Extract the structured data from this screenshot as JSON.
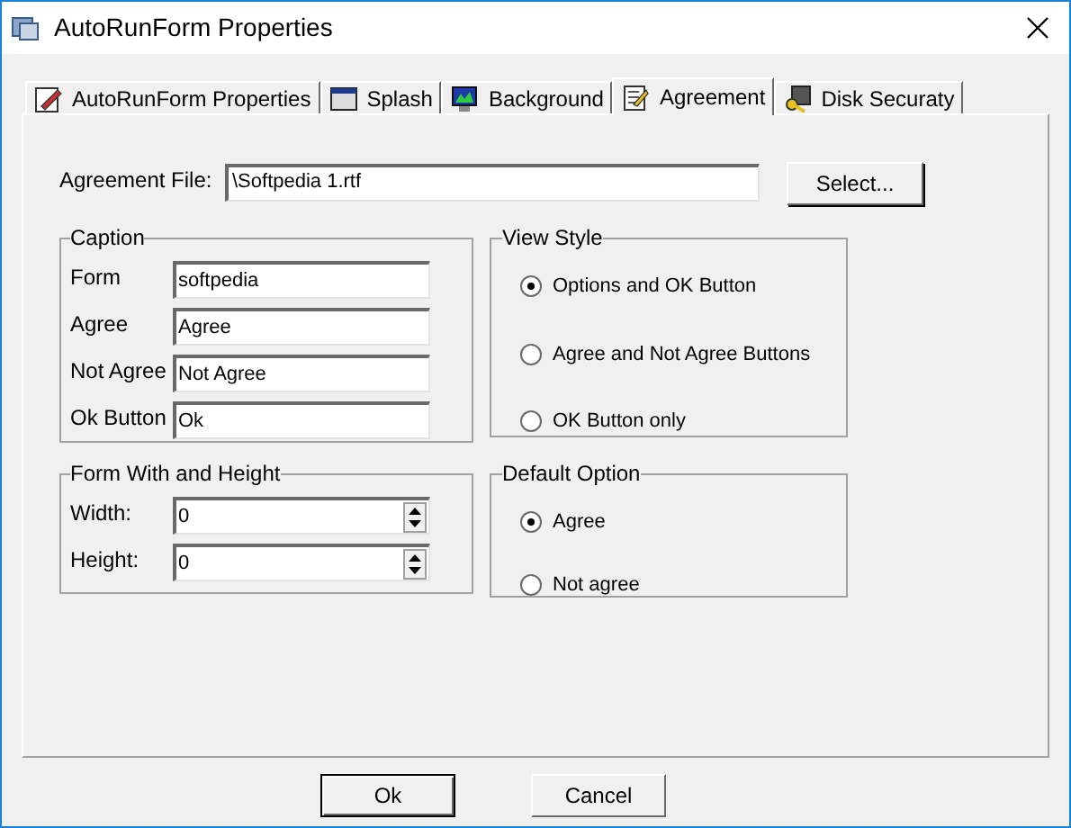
{
  "window": {
    "title": "AutoRunForm Properties"
  },
  "tabs": [
    {
      "label": "AutoRunForm Properties",
      "selected": false
    },
    {
      "label": "Splash",
      "selected": false
    },
    {
      "label": "Background",
      "selected": false
    },
    {
      "label": "Agreement",
      "selected": true
    },
    {
      "label": "Disk Securaty",
      "selected": false
    }
  ],
  "agreement_file": {
    "label": "Agreement File:",
    "value": "\\Softpedia 1.rtf",
    "button": "Select..."
  },
  "caption": {
    "title": "Caption",
    "fields": [
      {
        "label": "Form",
        "value": "softpedia"
      },
      {
        "label": "Agree",
        "value": "Agree"
      },
      {
        "label": "Not Agree",
        "value": "Not Agree"
      },
      {
        "label": "Ok Button",
        "value": "Ok"
      }
    ]
  },
  "view_style": {
    "title": "View Style",
    "options": [
      {
        "label": "Options and OK Button",
        "selected": true
      },
      {
        "label": "Agree and Not Agree Buttons",
        "selected": false
      },
      {
        "label": "OK Button only",
        "selected": false
      }
    ]
  },
  "form_size": {
    "title": "Form With and Height",
    "fields": [
      {
        "label": "Width:",
        "value": "0"
      },
      {
        "label": "Height:",
        "value": "0"
      }
    ]
  },
  "default_option": {
    "title": "Default Option",
    "options": [
      {
        "label": "Agree",
        "selected": true
      },
      {
        "label": "Not agree",
        "selected": false
      }
    ]
  },
  "buttons": [
    "Ok",
    "Cancel"
  ]
}
